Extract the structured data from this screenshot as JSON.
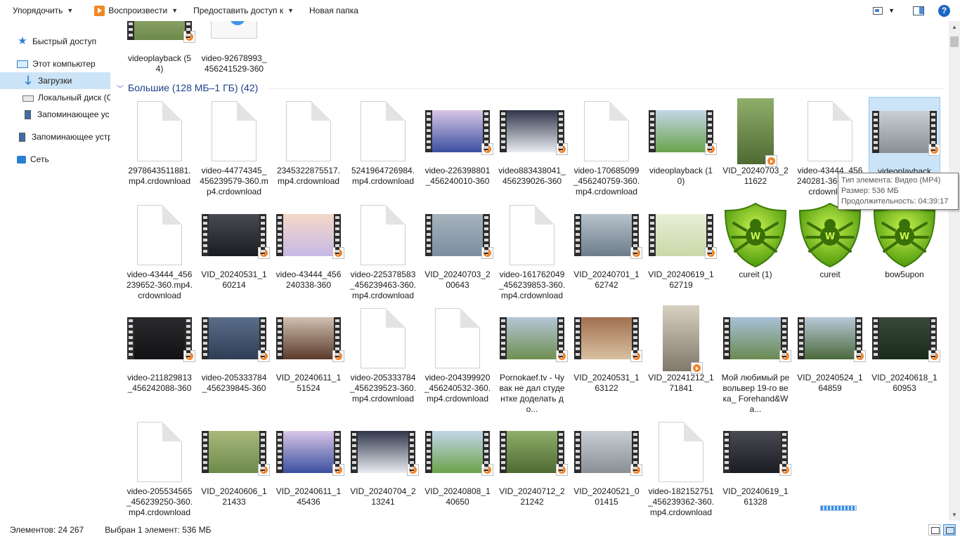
{
  "toolbar": {
    "organize": "Упорядочить",
    "play": "Воспроизвести",
    "share": "Предоставить доступ к",
    "new_folder": "Новая папка",
    "help": "?"
  },
  "nav": {
    "items": [
      {
        "label": "Быстрый доступ",
        "icon": "star-icon"
      },
      {
        "label": "Этот компьютер",
        "icon": "computer-icon"
      },
      {
        "label": "Загрузки",
        "icon": "download-arrow-icon",
        "selected": true
      },
      {
        "label": "Локальный диск (C",
        "icon": "drive-icon"
      },
      {
        "label": "Запоминающее ус",
        "icon": "usb-drive-icon"
      },
      {
        "label": "Запоминающее устр",
        "icon": "usb-drive-icon"
      },
      {
        "label": "Сеть",
        "icon": "network-icon"
      }
    ]
  },
  "group": {
    "label": "Большие (128 МБ–1 ГБ) (42)"
  },
  "top_items": [
    {
      "name": "videoplayback (54)",
      "kind": "video"
    },
    {
      "name": "video-92678993_456241529-360",
      "kind": "media"
    }
  ],
  "items": [
    {
      "name": "2978643511881.mp4.crdownload",
      "kind": "doc"
    },
    {
      "name": "video-44774345_456239579-360.mp4.crdownload",
      "kind": "doc"
    },
    {
      "name": "2345322875517.mp4.crdownload",
      "kind": "doc"
    },
    {
      "name": "5241964726984.mp4.crdownload",
      "kind": "doc"
    },
    {
      "name": "video-226398801_456240010-360",
      "kind": "video"
    },
    {
      "name": "video883438041_456239026-360",
      "kind": "video"
    },
    {
      "name": "video-170685099_456240759-360.mp4.crdownload",
      "kind": "doc"
    },
    {
      "name": "videoplayback (10)",
      "kind": "video"
    },
    {
      "name": "VID_20240703_211622",
      "kind": "tall"
    },
    {
      "name": "video-43444_456240281-360.mp4.crdownload",
      "kind": "doc"
    },
    {
      "name": "videoplayback",
      "kind": "video",
      "selected": true
    },
    {
      "name": "video-43444_456239652-360.mp4.crdownload",
      "kind": "doc"
    },
    {
      "name": "VID_20240531_160214",
      "kind": "video"
    },
    {
      "name": "video-43444_456240338-360",
      "kind": "video"
    },
    {
      "name": "video-225378583_456239463-360.mp4.crdownload",
      "kind": "doc"
    },
    {
      "name": "VID_20240703_200643",
      "kind": "video"
    },
    {
      "name": "video-161762049_456239853-360.mp4.crdownload",
      "kind": "doc"
    },
    {
      "name": "VID_20240701_162742",
      "kind": "video"
    },
    {
      "name": "VID_20240619_162719",
      "kind": "video"
    },
    {
      "name": "cureit (1)",
      "kind": "shield"
    },
    {
      "name": "cureit",
      "kind": "shield"
    },
    {
      "name": "bow5upon",
      "kind": "shield"
    },
    {
      "name": "video-211829813_456242088-360",
      "kind": "video"
    },
    {
      "name": "video-205333784_456239845-360",
      "kind": "video"
    },
    {
      "name": "VID_20240611_151524",
      "kind": "video"
    },
    {
      "name": "video-205333784_456239523-360.mp4.crdownload",
      "kind": "doc"
    },
    {
      "name": "video-204399920_456240532-360.mp4.crdownload",
      "kind": "doc"
    },
    {
      "name": "Pornokaef.tv - Чувак не дал студентке доделать до...",
      "kind": "video"
    },
    {
      "name": "VID_20240531_163122",
      "kind": "video"
    },
    {
      "name": "VID_20241212_171841",
      "kind": "tall"
    },
    {
      "name": "Мой любимый револьвер 19-го века_ Forehand&Wa...",
      "kind": "video"
    },
    {
      "name": "VID_20240524_164859",
      "kind": "video"
    },
    {
      "name": "VID_20240618_160953",
      "kind": "video"
    },
    {
      "name": "video-205534565_456239250-360.mp4.crdownload",
      "kind": "doc"
    },
    {
      "name": "VID_20240606_121433",
      "kind": "video"
    },
    {
      "name": "VID_20240611_145436",
      "kind": "video"
    },
    {
      "name": "VID_20240704_213241",
      "kind": "video"
    },
    {
      "name": "VID_20240808_140650",
      "kind": "video"
    },
    {
      "name": "VID_20240712_221242",
      "kind": "video"
    },
    {
      "name": "VID_20240521_001415",
      "kind": "video"
    },
    {
      "name": "video-182152751_456239362-360.mp4.crdownload",
      "kind": "doc"
    },
    {
      "name": "VID_20240619_161328",
      "kind": "video"
    }
  ],
  "tooltip": {
    "line1": "Тип элемента: Видео (MP4)",
    "line2": "Размер: 536 МБ",
    "line3": "Продолжительность: 04:39:17"
  },
  "status": {
    "count": "Элементов: 24 267",
    "selected": "Выбран 1 элемент: 536 МБ"
  },
  "colors": {
    "accent": "#0078d7",
    "selection": "#cce4f7",
    "group_header": "#1e3f8a",
    "shield": "#7cc31a"
  }
}
